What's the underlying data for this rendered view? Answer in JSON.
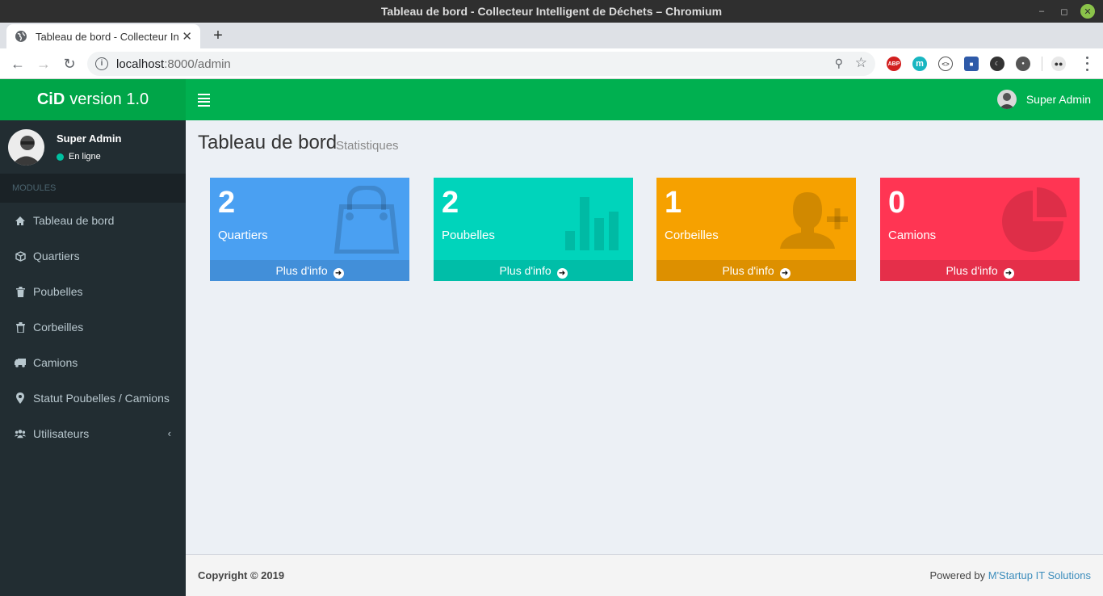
{
  "window": {
    "title": "Tableau de bord - Collecteur Intelligent de Déchets – Chromium"
  },
  "browser": {
    "tab_title": "Tableau de bord - Collecteur Intelligent de Déchets",
    "url_host": "localhost",
    "url_rest": ":8000/admin",
    "extensions": [
      "ABP",
      "m"
    ]
  },
  "header": {
    "logo_bold": "CiD",
    "logo_rest": "version 1.0",
    "user_name": "Super Admin"
  },
  "sidebar": {
    "user_name": "Super Admin",
    "user_status": "En ligne",
    "section_header": "MODULES",
    "items": [
      {
        "label": "Tableau de bord",
        "icon": "home-icon"
      },
      {
        "label": "Quartiers",
        "icon": "cube-icon"
      },
      {
        "label": "Poubelles",
        "icon": "trash-icon"
      },
      {
        "label": "Corbeilles",
        "icon": "trash-icon"
      },
      {
        "label": "Camions",
        "icon": "truck-icon"
      },
      {
        "label": "Statut Poubelles / Camions",
        "icon": "map-marker-icon"
      },
      {
        "label": "Utilisateurs",
        "icon": "users-icon"
      }
    ]
  },
  "main": {
    "title": "Tableau de bord",
    "subtitle": "Statistiques",
    "boxes": [
      {
        "value": "2",
        "label": "Quartiers",
        "footer": "Plus d'info",
        "color": "#4aa0f2",
        "icon": "shopping-bag-icon"
      },
      {
        "value": "2",
        "label": "Poubelles",
        "footer": "Plus d'info",
        "color": "#00d4bb",
        "icon": "bar-chart-icon"
      },
      {
        "value": "1",
        "label": "Corbeilles",
        "footer": "Plus d'info",
        "color": "#f6a100",
        "icon": "user-plus-icon"
      },
      {
        "value": "0",
        "label": "Camions",
        "footer": "Plus d'info",
        "color": "#ff3553",
        "icon": "pie-chart-icon"
      }
    ]
  },
  "footer": {
    "copyright": "Copyright © 2019",
    "powered_prefix": "Powered by",
    "powered_link": "M'Startup IT Solutions"
  },
  "colors": {
    "header_green": "#00b050",
    "sidebar_dark": "#222d32",
    "link_blue": "#3c8dbc"
  }
}
